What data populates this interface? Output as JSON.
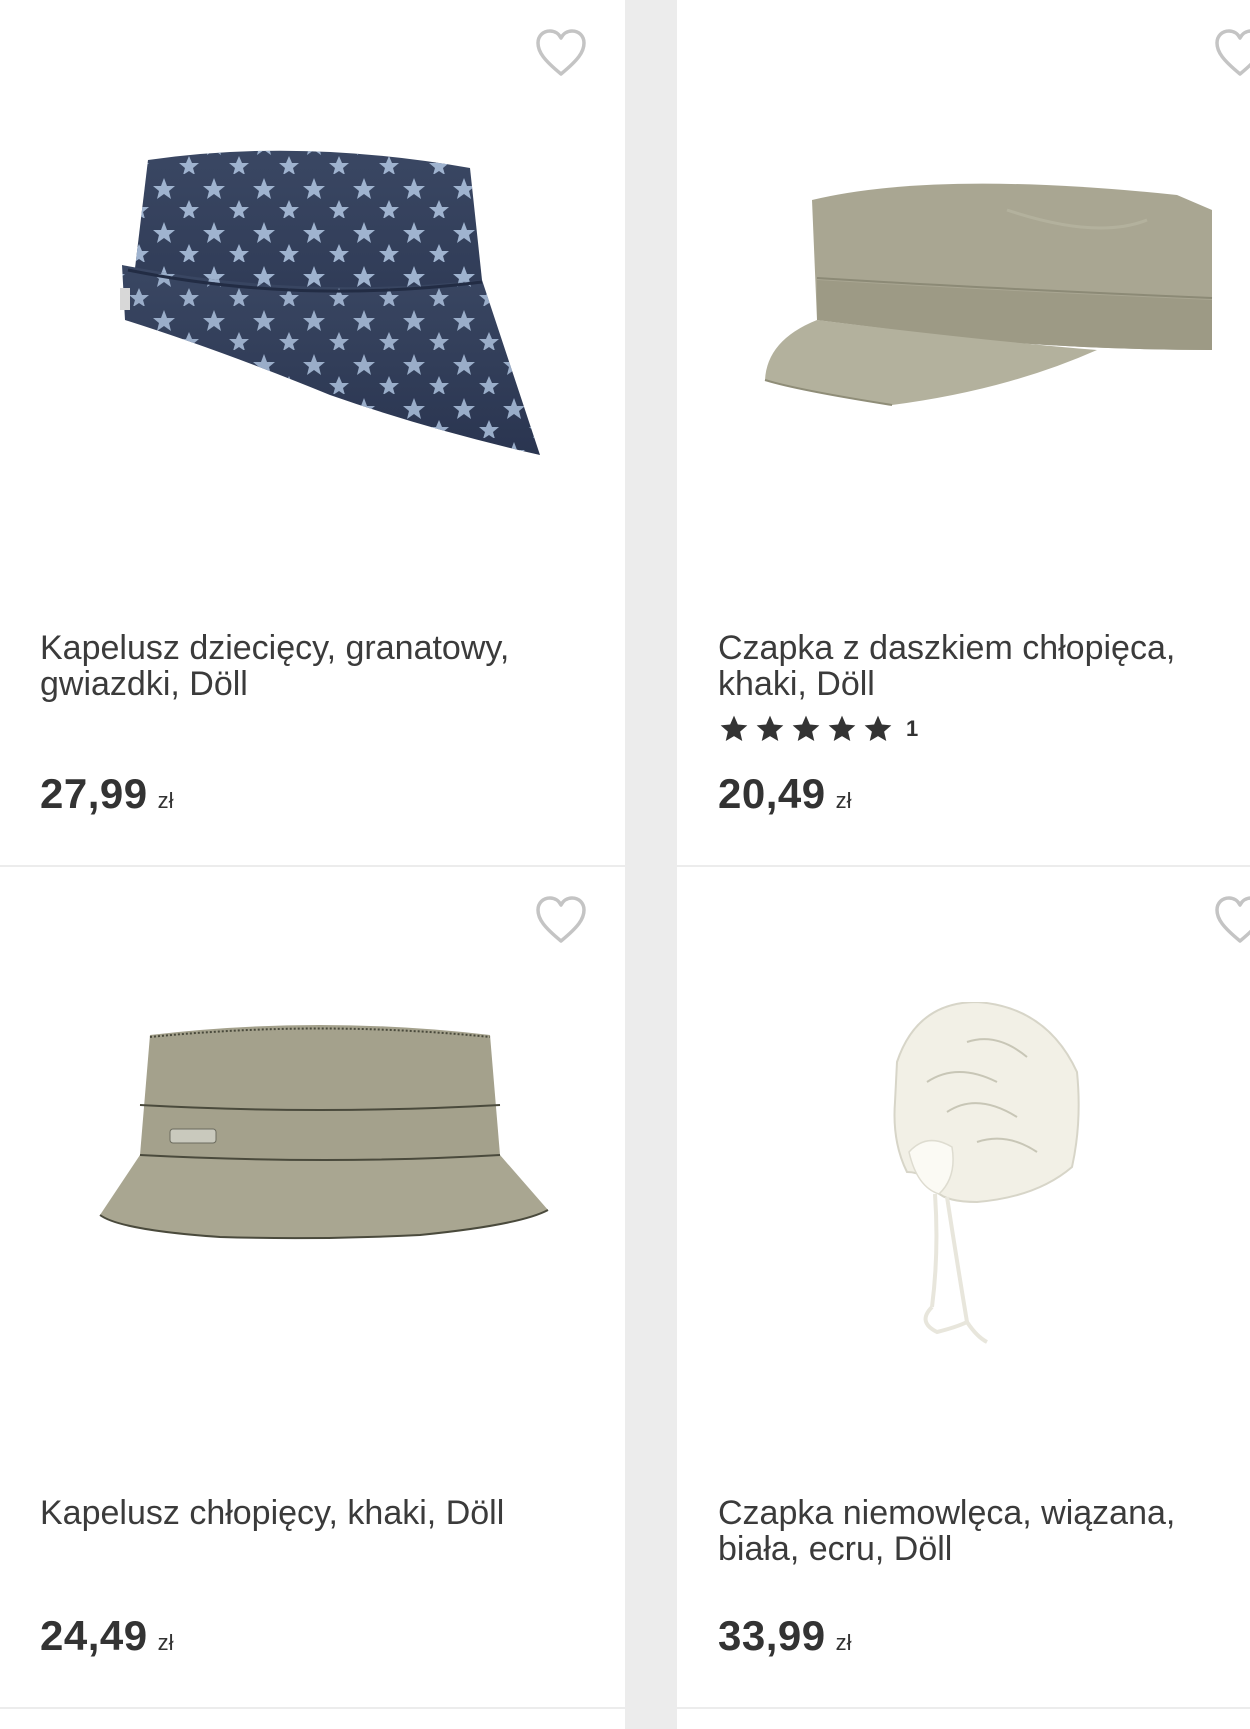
{
  "products": [
    {
      "title": "Kapelusz dziecięcy, granatowy, gwiazdki, Döll",
      "price": "27,99",
      "currency": "zł",
      "image": "navy-star-bucket-hat"
    },
    {
      "title": "Czapka z daszkiem chłopięca, khaki, Döll",
      "price": "20,49",
      "currency": "zł",
      "rating": {
        "stars": 5,
        "count": "1"
      },
      "image": "khaki-cadet-cap"
    },
    {
      "title": "Kapelusz chłopięcy, khaki, Döll",
      "price": "24,49",
      "currency": "zł",
      "image": "khaki-bucket-hat"
    },
    {
      "title": "Czapka niemowlęca, wiązana, biała, ecru, Döll",
      "price": "33,99",
      "currency": "zł",
      "image": "white-baby-tie-hat"
    }
  ],
  "icons": {
    "favorite": "heart-outline-icon",
    "rating": "star-icon"
  },
  "colors": {
    "background": "#ececec",
    "card": "#ffffff",
    "text": "#3b3b3b",
    "heart": "#bdbdbd",
    "star": "#333333"
  }
}
